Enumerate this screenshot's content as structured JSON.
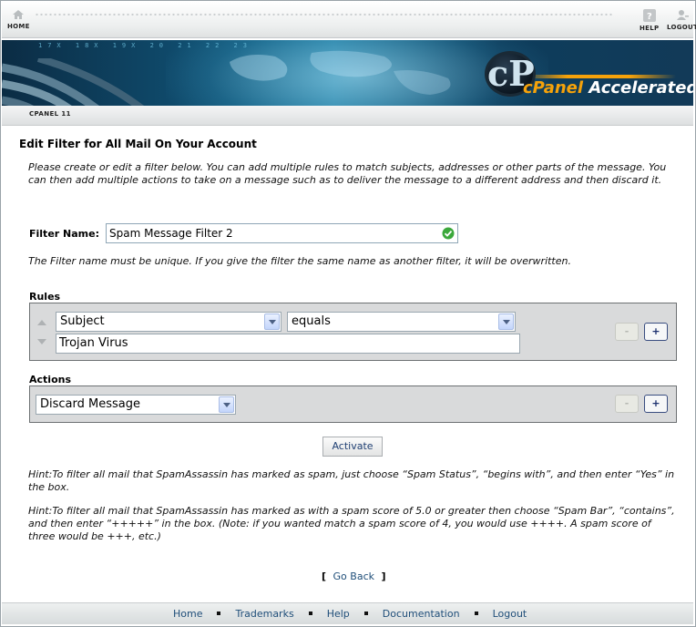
{
  "topnav": {
    "home_label": "HOME",
    "help_label": "HELP",
    "logout_label": "LOGOUT"
  },
  "brand": {
    "logo_letter": "cP",
    "logo_primary": "cPanel",
    "logo_secondary": "Accelerated",
    "banner_binary": "17X 18X 19X 20 21 22 23"
  },
  "breadcrumb": {
    "label": "CPANEL 11"
  },
  "page": {
    "title": "Edit Filter for All Mail On Your Account",
    "intro": "Please create or edit a filter below. You can add multiple rules to match subjects, addresses or other parts of the message. You can then add multiple actions to take on a message such as to deliver the message to a different address and then discard it.",
    "filter_name_label": "Filter Name:",
    "filter_name_value": "Spam Message Filter 2",
    "unique_note": "The Filter name must be unique. If you give the filter the same name as another filter, it will be overwritten."
  },
  "rules": {
    "label": "Rules",
    "field_select": "Subject",
    "operator_select": "equals",
    "value": "Trojan Virus",
    "remove_label": "-",
    "add_label": "+"
  },
  "actions": {
    "label": "Actions",
    "action_select": "Discard Message",
    "remove_label": "-",
    "add_label": "+"
  },
  "activate_label": "Activate",
  "hints": [
    "Hint:To filter all mail that SpamAssassin has marked as spam, just choose “Spam Status”, “begins with”, and then enter “Yes” in the box.",
    "Hint:To filter all mail that SpamAssassin has marked as with a spam score of 5.0 or greater then choose “Spam Bar”, “contains”, and then enter “+++++” in the box. (Note: if you wanted match a spam score of 4, you would use ++++. A spam score of three would be +++, etc.)"
  ],
  "goback": {
    "open": "[",
    "label": "Go Back",
    "close": "]"
  },
  "footer": {
    "links": [
      "Home",
      "Trademarks",
      "Help",
      "Documentation",
      "Logout"
    ]
  },
  "colors": {
    "link": "#1f4e79",
    "logo_orange": "#f5a20a",
    "panel_bg": "#d9dadb",
    "valid_green": "#3ba83b"
  }
}
